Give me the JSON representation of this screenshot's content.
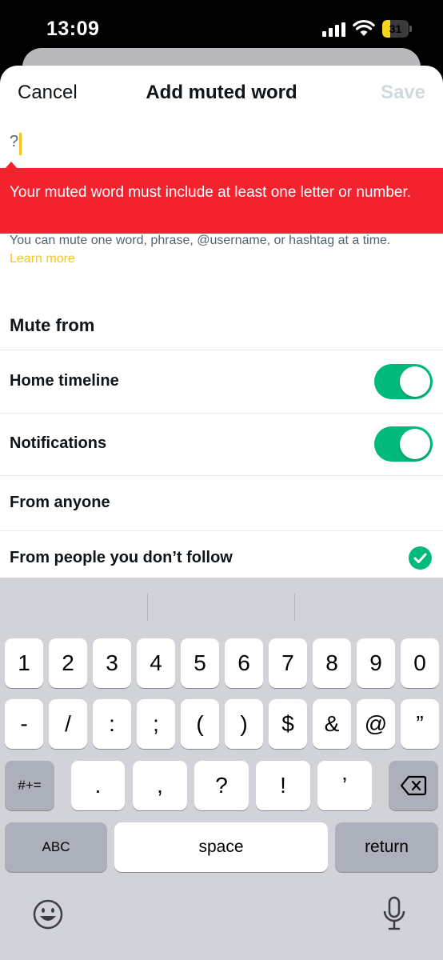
{
  "status_bar": {
    "time": "13:09",
    "battery_level": "31",
    "battery_fraction": 0.31
  },
  "nav": {
    "cancel_label": "Cancel",
    "title": "Add muted word",
    "save_label": "Save"
  },
  "input": {
    "value": "?"
  },
  "error": {
    "message": "Your muted word must include at least one letter or number."
  },
  "helper": {
    "text": "You can mute one word, phrase, @username, or hashtag at a time.",
    "learn_more": "Learn more"
  },
  "mute_from": {
    "title": "Mute from",
    "home_timeline": {
      "label": "Home timeline",
      "on": true
    },
    "notifications": {
      "label": "Notifications",
      "on": true
    },
    "audience_options": [
      {
        "label": "From anyone",
        "selected": false
      },
      {
        "label": "From people you don’t follow",
        "selected": true
      }
    ]
  },
  "keyboard": {
    "row1": [
      "1",
      "2",
      "3",
      "4",
      "5",
      "6",
      "7",
      "8",
      "9",
      "0"
    ],
    "row2": [
      "-",
      "/",
      ":",
      ";",
      "(",
      ")",
      "$",
      "&",
      "@",
      "”"
    ],
    "row3": [
      ".",
      ",",
      "?",
      "!",
      "’"
    ],
    "symbols_label": "#+=",
    "abc_label": "ABC",
    "space_label": "space",
    "return_label": "return"
  },
  "colors": {
    "accent": "#f7c61d",
    "error": "#f4212e",
    "toggle_on": "#00ba7c",
    "save_disabled": "#cfd9de"
  }
}
